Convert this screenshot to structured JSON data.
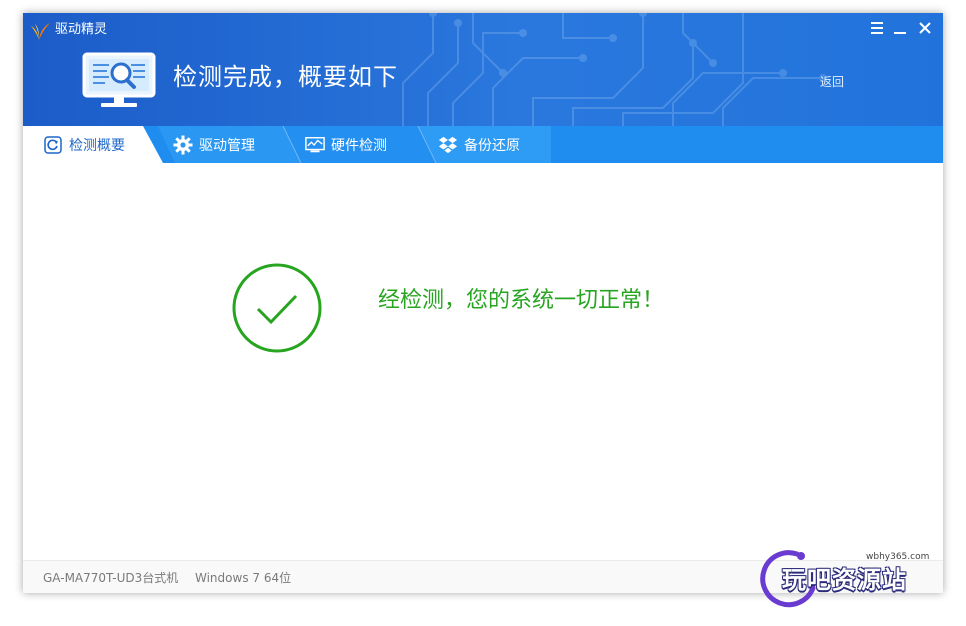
{
  "window": {
    "app_title": "驱动精灵",
    "headline": "检测完成，概要如下",
    "back_label": "返回"
  },
  "tabs": [
    {
      "label": "检测概要",
      "icon": "refresh-icon",
      "active": true
    },
    {
      "label": "驱动管理",
      "icon": "gear-icon",
      "active": false
    },
    {
      "label": "硬件检测",
      "icon": "chart-monitor-icon",
      "active": false
    },
    {
      "label": "备份还原",
      "icon": "dropbox-icon",
      "active": false
    }
  ],
  "main": {
    "result_text": "经检测，您的系统一切正常！",
    "status_color": "#27a521"
  },
  "footer": {
    "model": "GA-MA770T-UD3台式机",
    "os": "Windows 7 64位"
  },
  "watermark": {
    "url": "wbhy365.com",
    "text": "玩吧资源站"
  },
  "colors": {
    "header_blue": "#1f6fd8",
    "tab_bar": "#1f8df0",
    "active_tab_text": "#1e66c9"
  }
}
